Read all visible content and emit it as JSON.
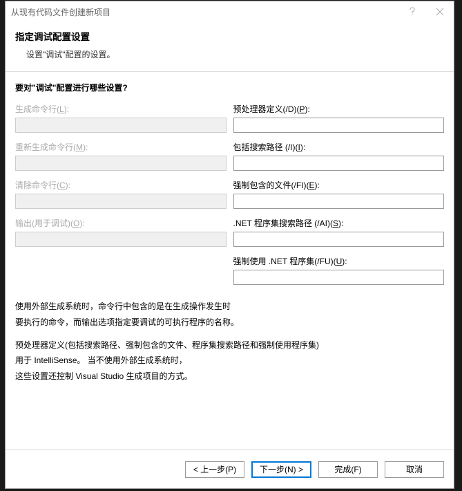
{
  "titlebar": {
    "title": "从现有代码文件创建新项目"
  },
  "header": {
    "title": "指定调试配置设置",
    "subtitle": "设置\"调试\"配置的设置。"
  },
  "section_title": "要对\"调试\"配置进行哪些设置?",
  "left_fields": {
    "build_cmd": {
      "label_pre": "生成命令行(",
      "mn": "L",
      "label_post": "):",
      "value": ""
    },
    "rebuild_cmd": {
      "label_pre": "重新生成命令行(",
      "mn": "M",
      "label_post": "):",
      "value": ""
    },
    "clean_cmd": {
      "label_pre": "清除命令行(",
      "mn": "C",
      "label_post": "):",
      "value": ""
    },
    "output": {
      "label_pre": "输出(用于调试)(",
      "mn": "O",
      "label_post": "):",
      "value": ""
    }
  },
  "right_fields": {
    "preproc": {
      "label_pre": "预处理器定义(/D)(",
      "mn": "P",
      "label_post": "):",
      "value": ""
    },
    "include": {
      "label_pre": "包括搜索路径 (/I)(",
      "mn": "I",
      "label_post": "):",
      "value": ""
    },
    "forced_inc": {
      "label_pre": "强制包含的文件(/FI)(",
      "mn": "E",
      "label_post": "):",
      "value": ""
    },
    "assembly_search": {
      "label_pre": ".NET 程序集搜索路径 (/AI)(",
      "mn": "S",
      "label_post": "):",
      "value": ""
    },
    "forced_using": {
      "label_pre": "强制使用 .NET 程序集(/FU)(",
      "mn": "U",
      "label_post": "):",
      "value": ""
    }
  },
  "description": {
    "p1a": "使用外部生成系统时，命令行中包含的是在生成操作发生时",
    "p1b": "要执行的命令，而输出选项指定要调试的可执行程序的名称。",
    "p2a": "预处理器定义(包括搜索路径、强制包含的文件、程序集搜索路径和强制使用程序集)",
    "p2b": "用于 IntelliSense。  当不使用外部生成系统时，",
    "p2c": "这些设置还控制 Visual Studio 生成项目的方式。"
  },
  "footer": {
    "prev": "< 上一步(P)",
    "next": "下一步(N) >",
    "finish": "完成(F)",
    "cancel": "取消"
  }
}
